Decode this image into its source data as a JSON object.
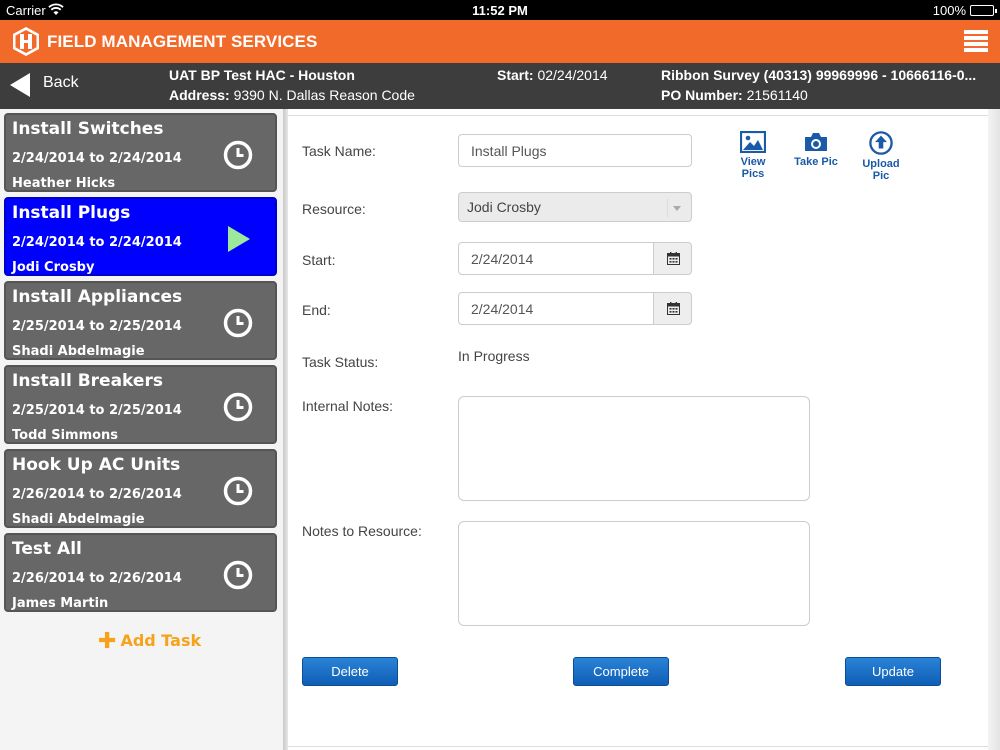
{
  "status_bar": {
    "carrier": "Carrier",
    "time": "11:52 PM",
    "battery": "100%"
  },
  "app": {
    "title": "FIELD MANAGEMENT SERVICES"
  },
  "header": {
    "back_label": "Back",
    "project": "UAT BP Test HAC - Houston",
    "address_label": "Address:",
    "address_value": "9390 N. Dallas Reason Code",
    "start_label": "Start:",
    "start_value": "02/24/2014",
    "survey": "Ribbon Survey (40313) 99969996 - 10666116-0...",
    "po_label": "PO Number:",
    "po_value": "21561140"
  },
  "tasks": [
    {
      "name": "Install Switches",
      "dates": "2/24/2014 to 2/24/2014",
      "person": "Heather Hicks",
      "icon": "clock-icon",
      "active": false
    },
    {
      "name": "Install Plugs",
      "dates": "2/24/2014 to 2/24/2014",
      "person": "Jodi Crosby",
      "icon": "play-icon",
      "active": true
    },
    {
      "name": "Install Appliances",
      "dates": "2/25/2014 to 2/25/2014",
      "person": "Shadi Abdelmagie",
      "icon": "clock-icon",
      "active": false
    },
    {
      "name": "Install Breakers",
      "dates": "2/25/2014 to 2/25/2014",
      "person": "Todd Simmons",
      "icon": "clock-icon",
      "active": false
    },
    {
      "name": "Hook Up AC Units",
      "dates": "2/26/2014 to 2/26/2014",
      "person": "Shadi Abdelmagie",
      "icon": "clock-icon",
      "active": false
    },
    {
      "name": "Test All",
      "dates": "2/26/2014 to 2/26/2014",
      "person": "James Martin",
      "icon": "clock-icon",
      "active": false
    }
  ],
  "add_task_label": "Add Task",
  "form": {
    "task_name_label": "Task Name:",
    "task_name_value": "Install Plugs",
    "resource_label": "Resource:",
    "resource_value": "Jodi Crosby",
    "start_label": "Start:",
    "start_value": "2/24/2014",
    "end_label": "End:",
    "end_value": "2/24/2014",
    "status_label": "Task Status:",
    "status_value": "In Progress",
    "internal_notes_label": "Internal Notes:",
    "notes_to_resource_label": "Notes to Resource:"
  },
  "pic_actions": {
    "view": "View Pics",
    "take": "Take Pic",
    "upload": "Upload Pic"
  },
  "buttons": {
    "delete": "Delete",
    "complete": "Complete",
    "update": "Update"
  },
  "colors": {
    "orange": "#f26a2a",
    "active_task": "#0000ff",
    "task_card": "#676767",
    "header": "#3d3d3d",
    "button_blue": "#1b6fc8",
    "add_task": "#f7a21b"
  }
}
